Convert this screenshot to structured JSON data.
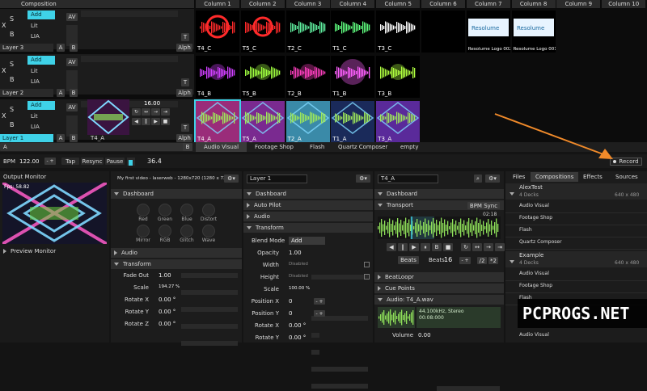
{
  "columns": [
    "Column 1",
    "Column 2",
    "Column 3",
    "Column 4",
    "Column 5",
    "Column 6",
    "Column 7",
    "Column 8",
    "Column 9",
    "Column 10"
  ],
  "layers": [
    {
      "name": "Layer 3",
      "blend": "Add",
      "lit": "Lit",
      "lia": "LIA",
      "clips": [
        "T4_C",
        "T5_C",
        "T2_C",
        "T1_C",
        "T3_C",
        "",
        "Resolume Logo 002",
        "Resolume Logo 001"
      ]
    },
    {
      "name": "Layer 2",
      "blend": "Add",
      "lit": "Lit",
      "lia": "LIA",
      "clips": [
        "T4_B",
        "T5_B",
        "T2_B",
        "T1_B",
        "T3_B"
      ]
    },
    {
      "name": "Layer 1",
      "blend": "Add",
      "lit": "Lit",
      "lia": "LIA",
      "clips": [
        "T4_A",
        "T5_A",
        "T2_A",
        "T1_A",
        "T3_A"
      ],
      "clip_preview": "T4_A",
      "speed": "16.00"
    }
  ],
  "letters": {
    "x": "X",
    "s": "S",
    "a": "A",
    "b": "B",
    "av": "AV",
    "t": "T",
    "alph": "Alph",
    "composition": "Composition"
  },
  "deck_tabs": [
    "Audio Visual",
    "Footage Shop",
    "Flash",
    "Quartz Composer",
    "empty"
  ],
  "transport_bar": {
    "bpm_label": "BPM",
    "bpm": "122.00",
    "tap": "Tap",
    "resync": "Resync",
    "pause": "Pause",
    "value": "36.4",
    "record": "Record"
  },
  "output": {
    "title": "Output Monitor",
    "fps": "Fps: 58.82",
    "preview": "Preview Monitor"
  },
  "comp_panel": {
    "title": "My first video - laserweb - 1280x720 (1280 x 720)",
    "dashboard": "Dashboard",
    "knobs": [
      "Red",
      "Green",
      "Blue",
      "Distort",
      "Mirror",
      "RGB",
      "Glitch",
      "Wave"
    ],
    "audio": "Audio",
    "transform": "Transform",
    "params": [
      {
        "label": "Fade Out",
        "value": "1.00"
      },
      {
        "label": "Scale",
        "value": "194.27 %"
      },
      {
        "label": "Rotate X",
        "value": "0.00 °"
      },
      {
        "label": "Rotate Y",
        "value": "0.00 °"
      },
      {
        "label": "Rotate Z",
        "value": "0.00 °"
      }
    ]
  },
  "layer_panel": {
    "name": "Layer 1",
    "dashboard": "Dashboard",
    "autopilot": "Auto Pilot",
    "audio": "Audio",
    "transform": "Transform",
    "blend_label": "Blend Mode",
    "blend": "Add",
    "params": [
      {
        "label": "Opacity",
        "value": "1.00"
      },
      {
        "label": "Width",
        "value": "Disabled"
      },
      {
        "label": "Height",
        "value": "Disabled"
      },
      {
        "label": "Scale",
        "value": "100.00 %"
      },
      {
        "label": "Position X",
        "value": "0"
      },
      {
        "label": "Position Y",
        "value": "0"
      },
      {
        "label": "Rotate X",
        "value": "0.00 °"
      },
      {
        "label": "Rotate Y",
        "value": "0.00 °"
      }
    ]
  },
  "clip_panel": {
    "name": "T4_A",
    "dashboard": "Dashboard",
    "transport": "Transport",
    "bpm_sync": "BPM Sync",
    "time": "02:18",
    "beats_label": "Beats",
    "beats_value": "16",
    "half": "/2",
    "double": "*2",
    "beatloopr": "BeatLoopr",
    "cue_points": "Cue Points",
    "audio_file": "Audio: T4_A.wav",
    "audio_info": "44.100kHz, Stereo",
    "audio_time": "00:08:000",
    "volume_label": "Volume",
    "volume_value": "0.00"
  },
  "browser": {
    "tabs": [
      "Files",
      "Compositions",
      "Effects",
      "Sources"
    ],
    "comps": [
      {
        "name": "AlexTest",
        "decks": "4 Decks",
        "size": "640 x 480",
        "items": [
          "Audio Visual",
          "Footage Shop",
          "Flash",
          "Quartz Composer"
        ]
      },
      {
        "name": "Example",
        "decks": "4 Decks",
        "size": "640 x 480",
        "items": [
          "Audio Visual",
          "Footage Shop",
          "Flash"
        ]
      }
    ],
    "last_item": "Audio Visual"
  },
  "watermark": "PCPROGS.NET",
  "colors": {
    "accent": "#3fd2e8",
    "arrow": "#f08a2a"
  }
}
